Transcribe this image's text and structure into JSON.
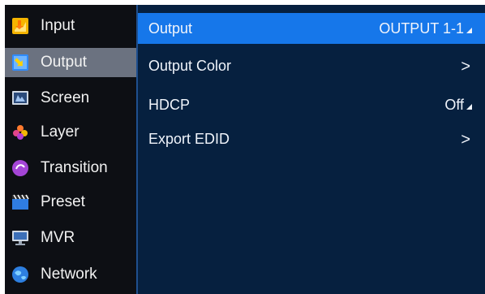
{
  "sidebar": {
    "items": [
      {
        "label": "Input",
        "icon": "input-icon"
      },
      {
        "label": "Output",
        "icon": "output-icon",
        "selected": true
      },
      {
        "label": "Screen",
        "icon": "screen-icon"
      },
      {
        "label": "Layer",
        "icon": "layer-icon"
      },
      {
        "label": "Transition",
        "icon": "transition-icon"
      },
      {
        "label": "Preset",
        "icon": "preset-icon"
      },
      {
        "label": "MVR",
        "icon": "mvr-icon"
      },
      {
        "label": "Network",
        "icon": "network-icon"
      }
    ]
  },
  "main": {
    "header": {
      "label": "Output",
      "value": "OUTPUT 1-1"
    },
    "rows": [
      {
        "label": "Output Color",
        "value": ">"
      },
      {
        "label": "HDCP",
        "value": "Off"
      },
      {
        "label": "Export EDID",
        "value": ">"
      }
    ]
  },
  "colors": {
    "accent": "#1677ea",
    "panel": "#06203f",
    "sidebar": "#0d0f14",
    "selected": "#6b7280"
  }
}
